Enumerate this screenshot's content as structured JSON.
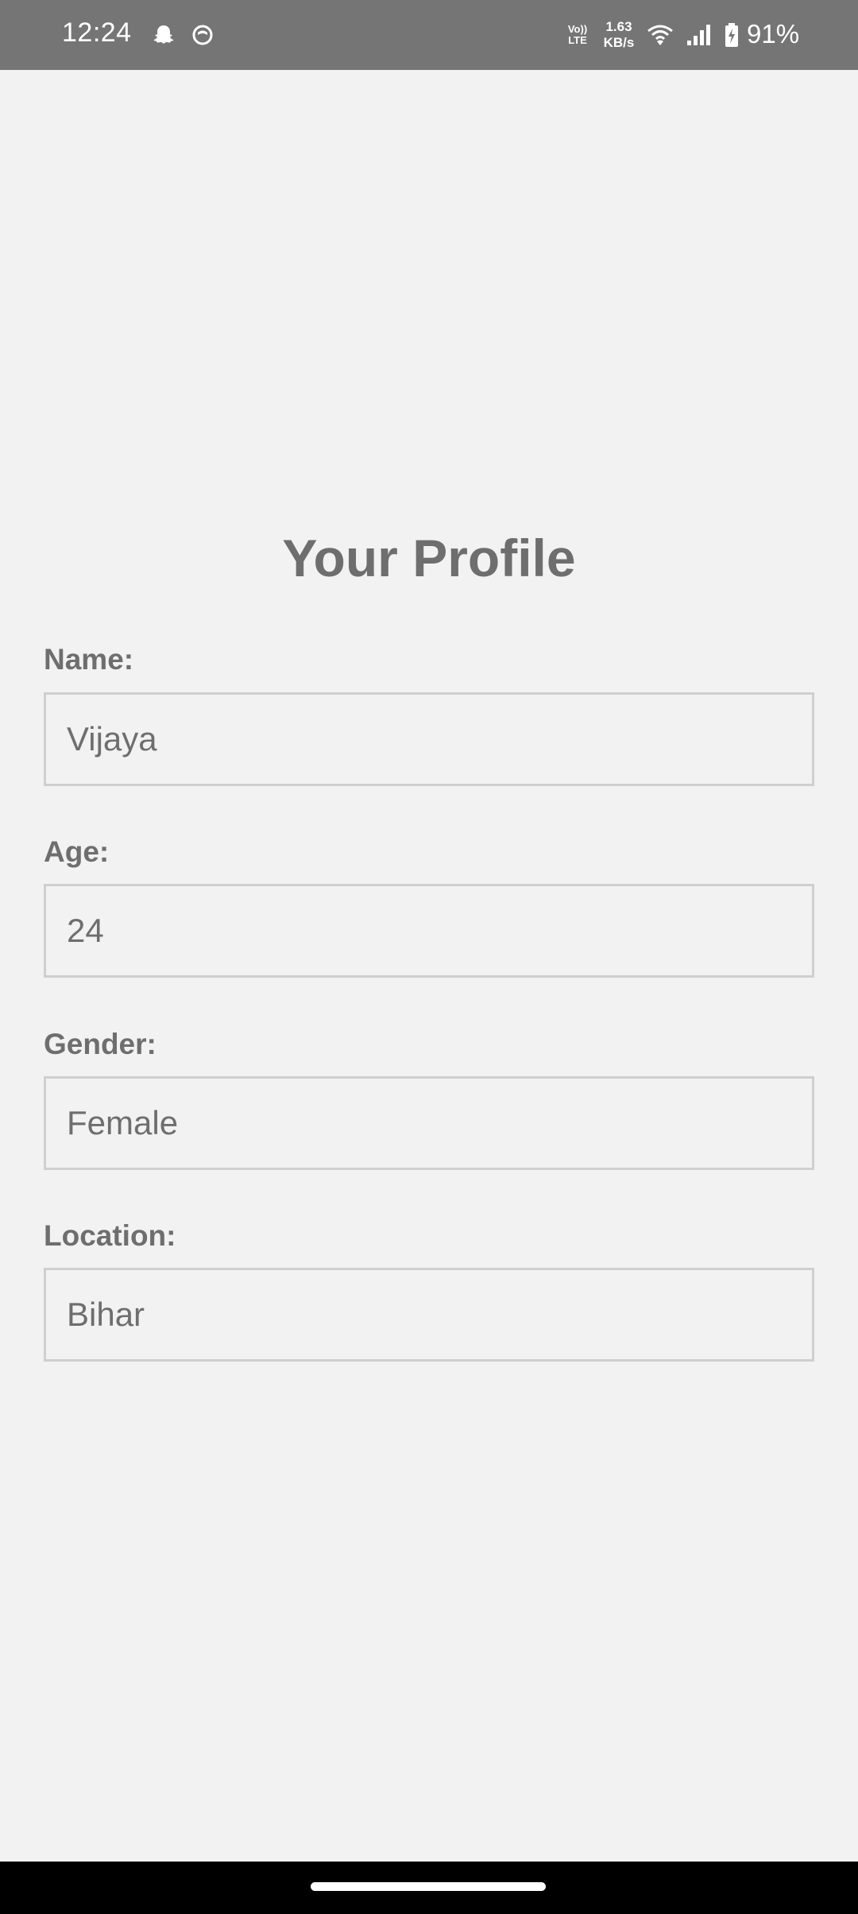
{
  "status_bar": {
    "time": "12:24",
    "network_type_top": "Vo))",
    "network_type_bottom": "LTE",
    "speed_value": "1.63",
    "speed_unit": "KB/s",
    "battery_percent": "91%",
    "icons": [
      "snapchat-icon",
      "circle-app-icon",
      "wifi-icon",
      "signal-icon",
      "battery-charging-icon"
    ]
  },
  "profile": {
    "title": "Your Profile",
    "fields": [
      {
        "label": "Name:",
        "value": "Vijaya"
      },
      {
        "label": "Age:",
        "value": "24"
      },
      {
        "label": "Gender:",
        "value": "Female"
      },
      {
        "label": "Location:",
        "value": "Bihar"
      }
    ]
  },
  "colors": {
    "status_bar_bg": "#757575",
    "page_bg": "#f2f2f2",
    "text": "#6e6e6e",
    "field_border": "#cfcfcf",
    "nav_bar_bg": "#000000"
  }
}
